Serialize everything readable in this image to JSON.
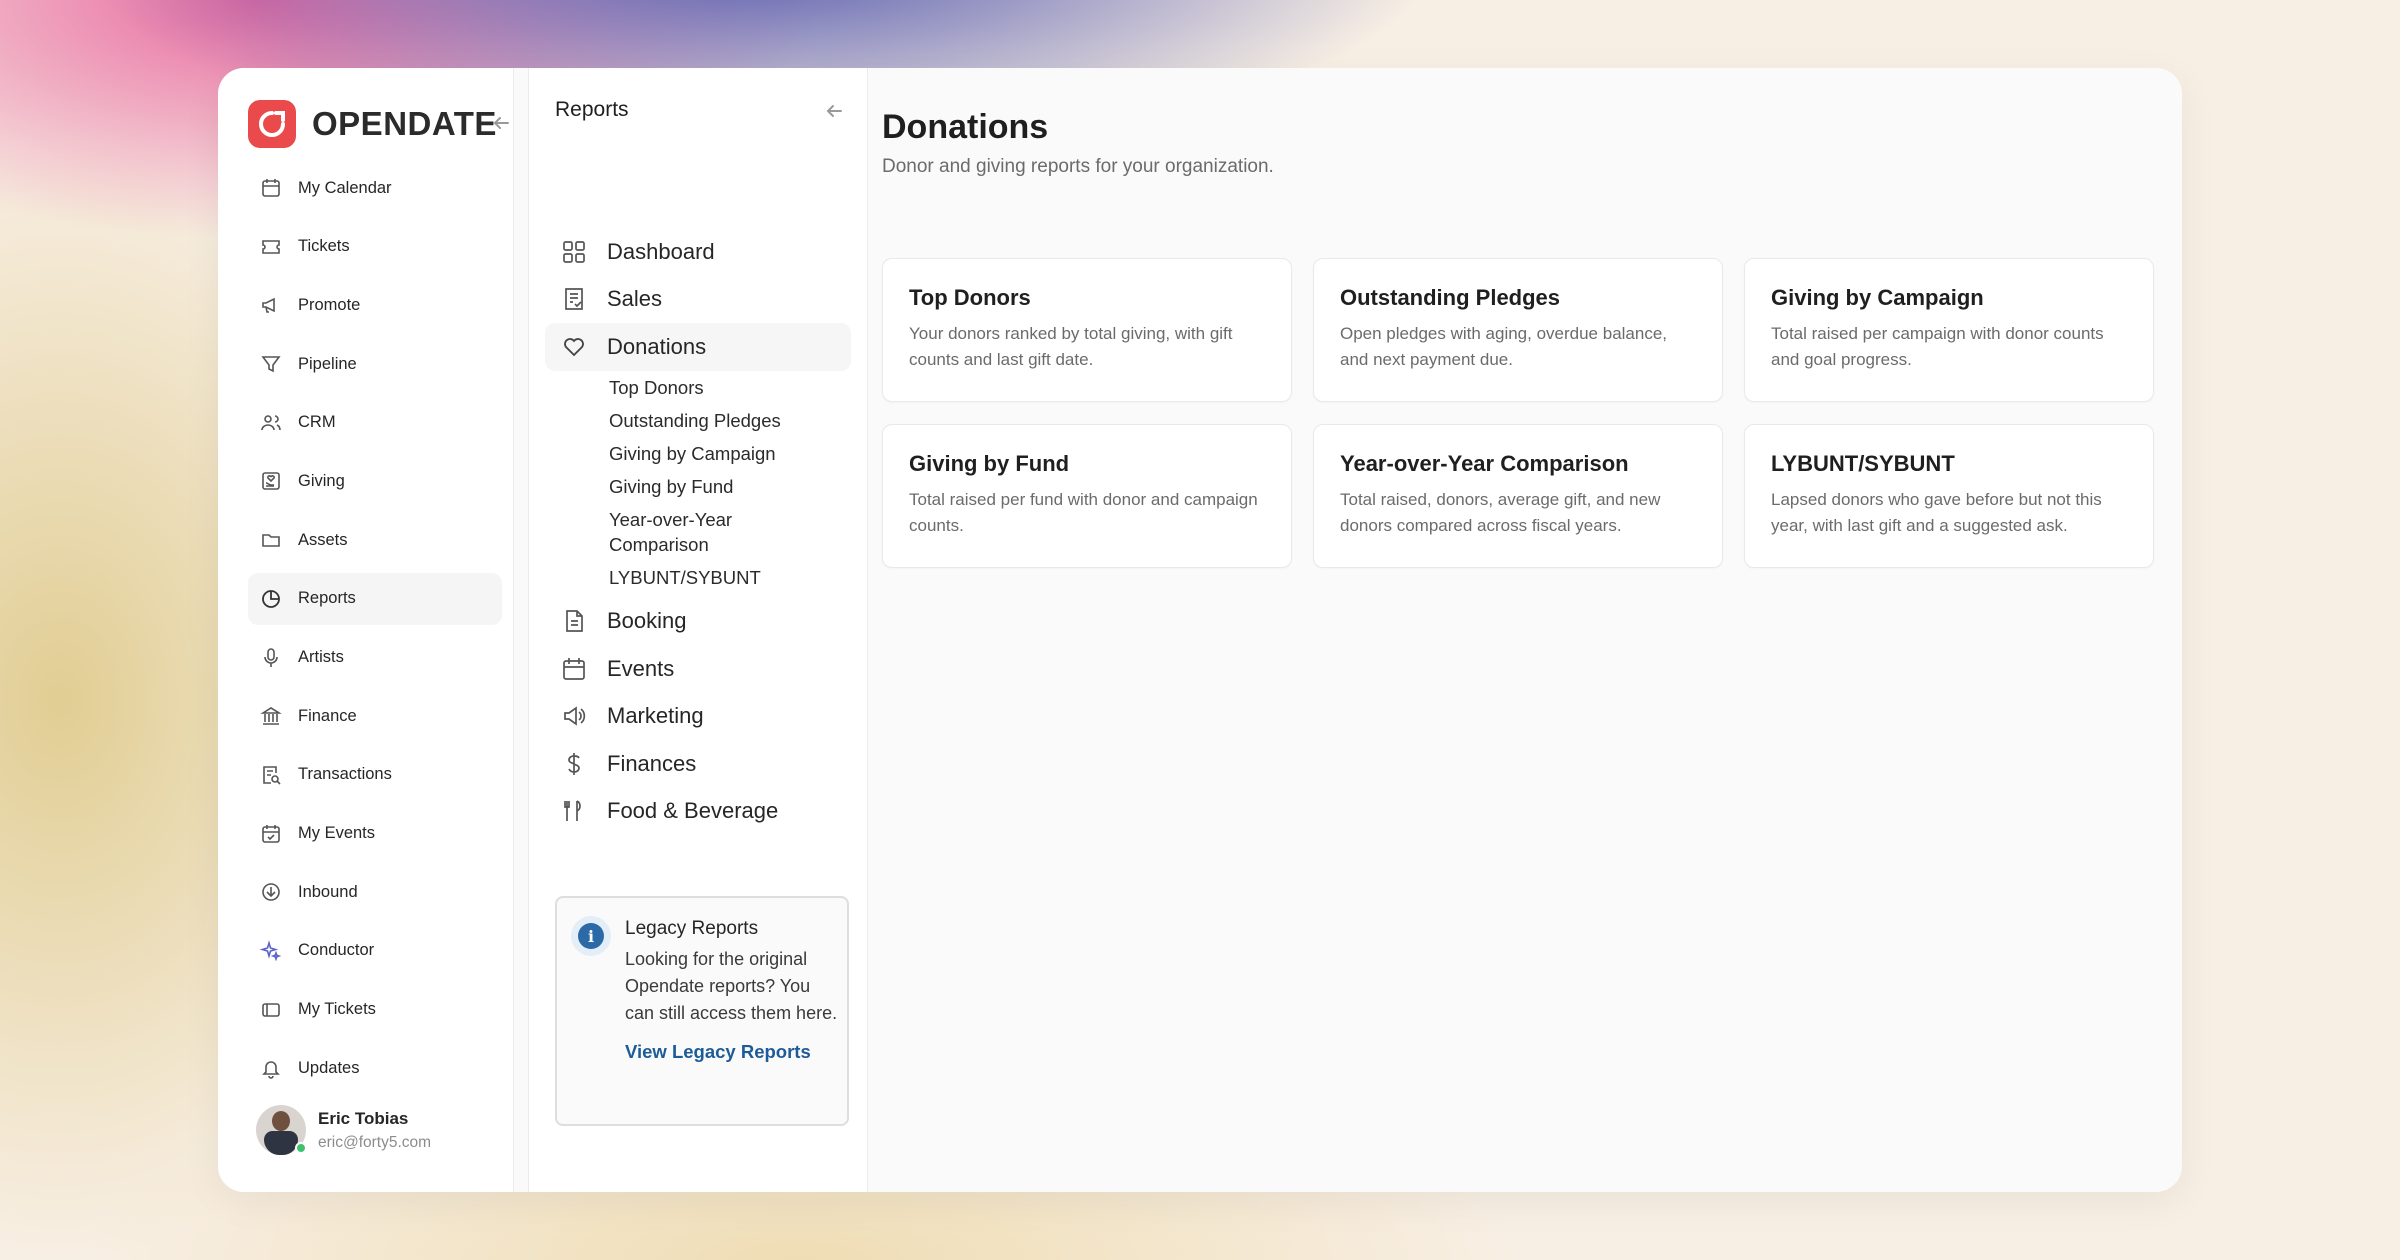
{
  "brand": {
    "name": "OPENDATE",
    "accent": "#ea4a4c"
  },
  "sidebar": {
    "items": [
      {
        "label": "My Calendar",
        "icon": "calendar-icon"
      },
      {
        "label": "Tickets",
        "icon": "ticket-icon"
      },
      {
        "label": "Promote",
        "icon": "megaphone-icon"
      },
      {
        "label": "Pipeline",
        "icon": "funnel-icon"
      },
      {
        "label": "CRM",
        "icon": "users-icon"
      },
      {
        "label": "Giving",
        "icon": "giving-icon"
      },
      {
        "label": "Assets",
        "icon": "folder-icon"
      },
      {
        "label": "Reports",
        "icon": "pie-chart-icon",
        "active": true
      },
      {
        "label": "Artists",
        "icon": "microphone-icon"
      },
      {
        "label": "Finance",
        "icon": "bank-icon"
      },
      {
        "label": "Transactions",
        "icon": "receipt-search-icon"
      },
      {
        "label": "My Events",
        "icon": "calendar-check-icon"
      },
      {
        "label": "Inbound",
        "icon": "inbound-icon"
      },
      {
        "label": "Conductor",
        "icon": "sparkle-icon"
      },
      {
        "label": "My Tickets",
        "icon": "my-tickets-icon"
      },
      {
        "label": "Updates",
        "icon": "bell-icon"
      }
    ],
    "user": {
      "name": "Eric Tobias",
      "email": "eric@forty5.com"
    }
  },
  "reports_panel": {
    "title": "Reports",
    "items": [
      {
        "label": "Dashboard",
        "icon": "grid-icon"
      },
      {
        "label": "Sales",
        "icon": "sales-icon"
      },
      {
        "label": "Donations",
        "icon": "heart-icon",
        "active": true
      }
    ],
    "donations_sub": [
      "Top Donors",
      "Outstanding Pledges",
      "Giving by Campaign",
      "Giving by Fund",
      "Year-over-Year Comparison",
      "LYBUNT/SYBUNT"
    ],
    "more_items": [
      {
        "label": "Booking",
        "icon": "document-icon"
      },
      {
        "label": "Events",
        "icon": "calendar-icon"
      },
      {
        "label": "Marketing",
        "icon": "speaker-icon"
      },
      {
        "label": "Finances",
        "icon": "dollar-icon"
      },
      {
        "label": "Food & Beverage",
        "icon": "utensils-icon"
      }
    ],
    "legacy": {
      "title": "Legacy Reports",
      "body": "Looking for the original Opendate reports? You can still access them here.",
      "link": "View Legacy Reports"
    }
  },
  "main": {
    "title": "Donations",
    "subtitle": "Donor and giving reports for your organization.",
    "cards": [
      {
        "title": "Top Donors",
        "desc": "Your donors ranked by total giving, with gift counts and last gift date."
      },
      {
        "title": "Outstanding Pledges",
        "desc": "Open pledges with aging, overdue balance, and next payment due."
      },
      {
        "title": "Giving by Campaign",
        "desc": "Total raised per campaign with donor counts and goal progress."
      },
      {
        "title": "Giving by Fund",
        "desc": "Total raised per fund with donor and campaign counts."
      },
      {
        "title": "Year-over-Year Comparison",
        "desc": "Total raised, donors, average gift, and new donors compared across fiscal years."
      },
      {
        "title": "LYBUNT/SYBUNT",
        "desc": "Lapsed donors who gave before but not this year, with last gift and a suggested ask."
      }
    ]
  }
}
